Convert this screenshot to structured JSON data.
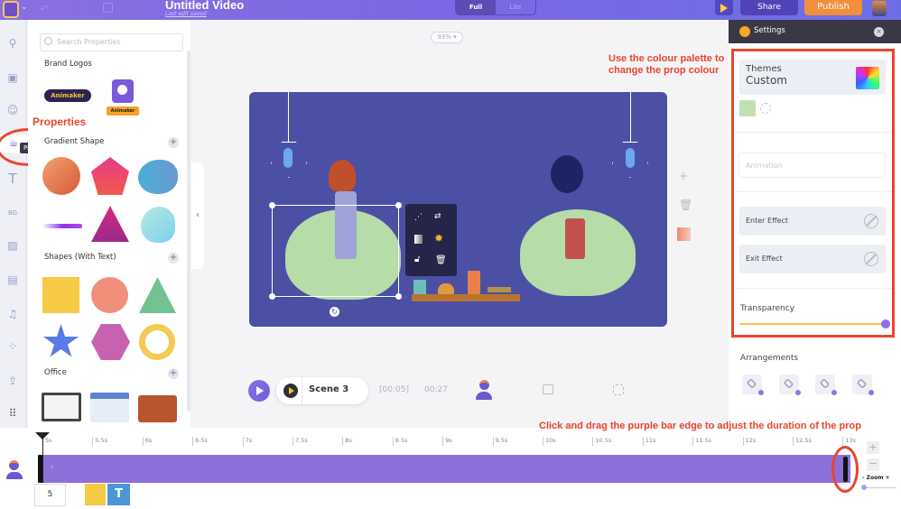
{
  "topbar": {
    "title": "Untitled Video",
    "save_status": "Last edit saved",
    "modes": [
      "Full",
      "Lite"
    ],
    "active_mode": "Full",
    "share_label": "Share",
    "publish_label": "Publish"
  },
  "iconbar": {
    "items": [
      "search-icon",
      "scene-icon",
      "character-icon",
      "properties-icon",
      "text-icon",
      "background-icon",
      "image-icon",
      "video-icon",
      "music-icon",
      "effects-icon",
      "upload-icon",
      "more-icon"
    ],
    "active": "properties-icon",
    "tooltip": "Properties"
  },
  "panel": {
    "search_placeholder": "Search Properties",
    "sections": [
      {
        "title": "Brand Logos",
        "items": [
          "Animaker wordmark",
          "Animaker robot logo"
        ]
      },
      {
        "title": "Gradient Shape",
        "items": [
          "gradient-blob-orange",
          "gradient-pentagon",
          "gradient-blob-blue",
          "gradient-brush",
          "gradient-triangle",
          "gradient-blob-cyan"
        ]
      },
      {
        "title": "Shapes (With Text)",
        "items": [
          "square",
          "circle",
          "triangle",
          "star",
          "hexagon",
          "ring"
        ]
      },
      {
        "title": "Office",
        "items": [
          "monitor",
          "calendar",
          "briefcase"
        ]
      }
    ]
  },
  "canvas": {
    "zoom": "93%",
    "scene_label": "Scene 3",
    "scene_time": "[00:05]",
    "total_time": "00:27"
  },
  "annotations": {
    "properties": "Properties",
    "palette_hint": "Use the colour palette to change the prop colour",
    "duration_hint": "Click and drag the purple bar edge to adjust the duration of the prop"
  },
  "settings": {
    "title": "Settings",
    "themes_label": "Themes",
    "themes_value": "Custom",
    "swatch_color": "#bfe0b0",
    "animation_placeholder": "Animation",
    "enter_effect": "Enter Effect",
    "exit_effect": "Exit Effect",
    "transparency_label": "Transparency",
    "transparency_value": 100,
    "arrangements_label": "Arrangements"
  },
  "timeline": {
    "ticks": [
      "5s",
      "5.5s",
      "6s",
      "6.5s",
      "7s",
      "7.5s",
      "8s",
      "8.5s",
      "9s",
      "9.5s",
      "10s",
      "10.5s",
      "11s",
      "11.5s",
      "12s",
      "12.5s",
      "13s"
    ],
    "duration_value": "5",
    "zoom_label": "Zoom",
    "zoom_minus": "-",
    "zoom_plus": "+"
  },
  "colors": {
    "brand_purple": "#7a68e4",
    "publish_orange": "#f18f3a",
    "annotation_red": "#e8452c",
    "track_purple": "#8c6fd8",
    "stage_bg": "#4c50a4"
  }
}
